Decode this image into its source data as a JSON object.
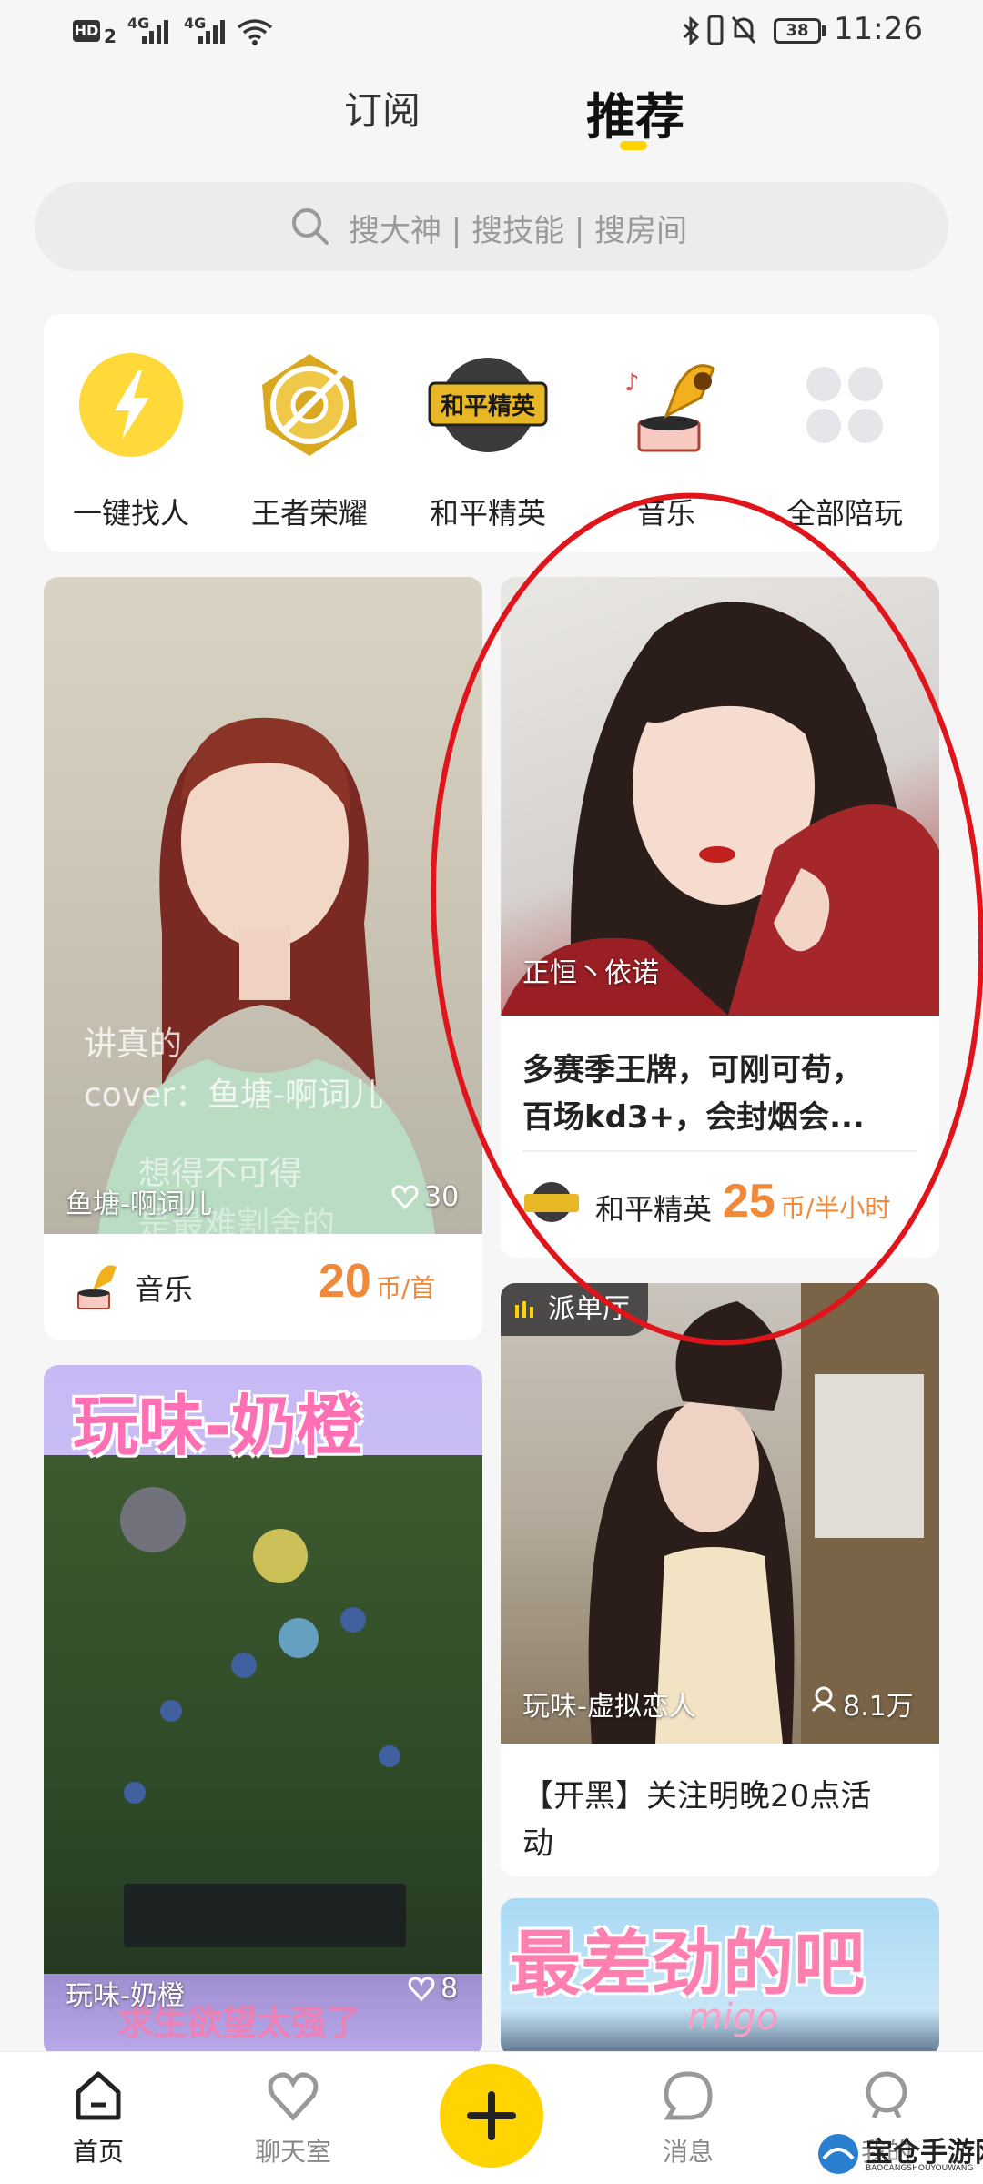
{
  "status_bar": {
    "hd": "HD",
    "hd_sub": "2",
    "net1": "4G",
    "net2": "4G",
    "battery": "38",
    "time": "11:26"
  },
  "top_tabs": {
    "subscribe": "订阅",
    "recommend": "推荐"
  },
  "search": {
    "placeholder": "搜大神 | 搜技能 | 搜房间"
  },
  "categories": [
    {
      "label": "一键找人",
      "icon": "lightning-icon"
    },
    {
      "label": "王者荣耀",
      "icon": "honor-of-kings-icon"
    },
    {
      "label": "和平精英",
      "icon": "peace-elite-icon",
      "badge_text": "和平精英"
    },
    {
      "label": "音乐",
      "icon": "gramophone-icon"
    },
    {
      "label": "全部陪玩",
      "icon": "all-grid-icon"
    }
  ],
  "cards": {
    "card1": {
      "overlay_text_1": "讲真的",
      "overlay_text_2": "cover：鱼塘-啊词儿",
      "overlay_text_3": "想得不可得",
      "overlay_text_4": "是最难割舍的",
      "name": "鱼塘-啊词儿",
      "likes": "30",
      "category": "音乐",
      "price": "20",
      "unit": "币/首"
    },
    "card2": {
      "name": "正恒丶依诺",
      "desc_line1": "多赛季王牌，可刚可苟，",
      "desc_line2": "百场kd3+，会封烟会...",
      "game": "和平精英",
      "price": "25",
      "unit": "币/半小时"
    },
    "card3": {
      "banner": "玩味-奶橙",
      "overlay_bottom": "求生欲望太强了",
      "name": "玩味-奶橙",
      "likes": "8"
    },
    "card4": {
      "tag": "派单厅",
      "name": "玩味-虚拟恋人",
      "listeners": "8.1万",
      "desc_line1": "【开黑】关注明晚20点活",
      "desc_line2": "动"
    },
    "card5": {
      "banner": "最差劲的吧",
      "sub": "migo"
    }
  },
  "bottom_nav": [
    {
      "label": "首页",
      "icon": "home-icon"
    },
    {
      "label": "聊天室",
      "icon": "heart-icon"
    },
    {
      "label": "",
      "icon": "plus-icon"
    },
    {
      "label": "消息",
      "icon": "message-icon"
    },
    {
      "label": "我的",
      "icon": "profile-icon"
    }
  ],
  "watermark": {
    "title": "宝仓手游网",
    "url": "BAOCANGSHOUYOUWANG"
  },
  "colors": {
    "accent": "#ffd200",
    "price": "#f08a3a",
    "annotation": "#e0151b"
  }
}
